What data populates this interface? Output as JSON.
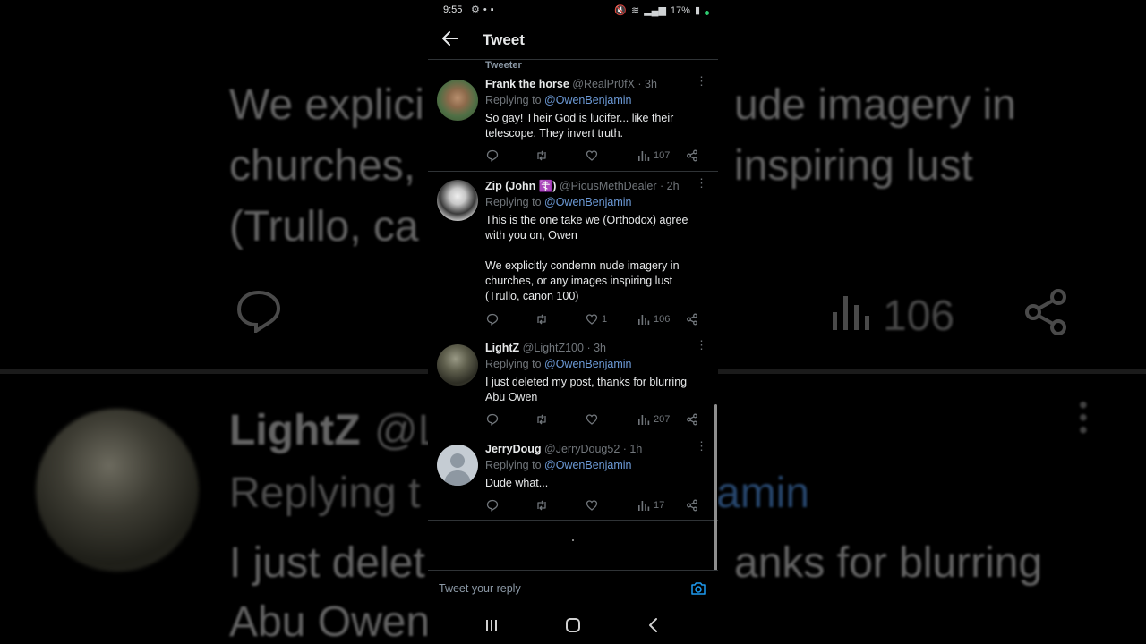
{
  "status_bar": {
    "time": "9:55",
    "battery": "17%"
  },
  "header": {
    "title": "Tweet"
  },
  "feed": {
    "section_label": "Tweeter",
    "tweets": [
      {
        "name": "Frank the horse",
        "handle": "@RealPr0fX",
        "age": "· 3h",
        "replying_prefix": "Replying to ",
        "replying_to": "@OwenBenjamin",
        "body": "So gay!  Their God is lucifer... like their telescope. They invert truth.",
        "reply_count": "",
        "retweet_count": "",
        "like_count": "",
        "view_count": "107"
      },
      {
        "name": "Zip (John ☦️)",
        "handle": "@PiousMethDealer",
        "age": "· 2h",
        "replying_prefix": "Replying to ",
        "replying_to": "@OwenBenjamin",
        "body": "This is the one take we (Orthodox) agree with you on, Owen\n\nWe explicitly condemn nude imagery in churches, or any images inspiring lust (Trullo, canon 100)",
        "reply_count": "",
        "retweet_count": "",
        "like_count": "1",
        "view_count": "106"
      },
      {
        "name": "LightZ",
        "handle": "@LightZ100",
        "age": "· 3h",
        "replying_prefix": "Replying to ",
        "replying_to": "@OwenBenjamin",
        "body": "I just deleted my post, thanks for blurring Abu Owen",
        "reply_count": "",
        "retweet_count": "",
        "like_count": "",
        "view_count": "207"
      },
      {
        "name": "JerryDoug",
        "handle": "@JerryDoug52",
        "age": "· 1h",
        "replying_prefix": "Replying to ",
        "replying_to": "@OwenBenjamin",
        "body": "Dude what...",
        "reply_count": "",
        "retweet_count": "",
        "like_count": "",
        "view_count": "17"
      }
    ]
  },
  "composer": {
    "placeholder": "Tweet your reply"
  },
  "background": {
    "line1": "We explici",
    "line1b": "ude imagery in",
    "line2": "churches,",
    "line2b": "inspiring lust",
    "line3": "(Trullo, ca",
    "views": "106",
    "name": "LightZ",
    "handle_part": "@L",
    "replying_part": "Replying t",
    "mention_part": "amin",
    "body_part1": "I just delet",
    "body_part1b": "anks for blurring",
    "body_part2": "Abu Owen"
  },
  "colors": {
    "background": "#000000",
    "text": "#e7e9ea",
    "muted": "#71767b",
    "mention": "#6d9bd8",
    "divider": "#2f3336"
  },
  "icons": [
    "back-arrow-icon",
    "reply-icon",
    "retweet-icon",
    "like-icon",
    "views-icon",
    "share-icon",
    "more-icon",
    "camera-icon",
    "recents-icon",
    "home-icon",
    "nav-back-icon"
  ]
}
